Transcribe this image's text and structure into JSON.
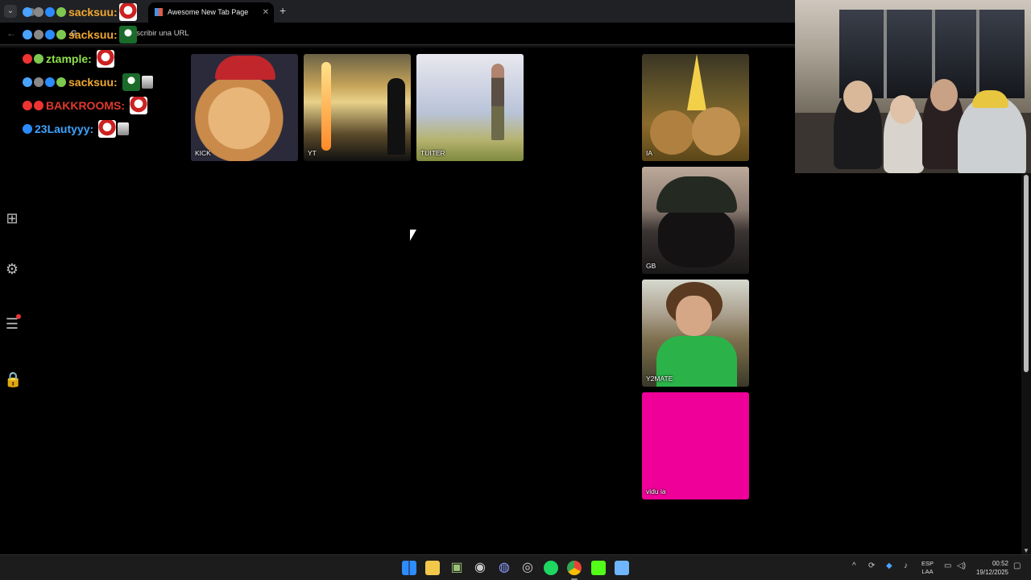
{
  "browser": {
    "tabs": [
      {
        "title": "",
        "active": false
      },
      {
        "title": "Awesome New Tab Page",
        "active": true
      }
    ],
    "new_tab_symbol": "+",
    "address_placeholder": "Busca en Google o escribe una URL",
    "address_visible_fragment": "o escribir una URL"
  },
  "chat": {
    "overlay_top": {
      "user": "sacksuu:",
      "color": "#f0a830"
    },
    "overlay_address": {
      "user": "sacksuu:",
      "color": "#f0a830"
    },
    "messages": [
      {
        "user": "ztample:",
        "color": "#8fe04a"
      },
      {
        "user": "sacksuu:",
        "color": "#f0a830"
      },
      {
        "user": "BAKKROOMS:",
        "color": "#e0392b"
      },
      {
        "user": "23Lautyyy:",
        "color": "#3fa4ff"
      }
    ]
  },
  "sidebar": {
    "icons": [
      "add-tile-icon",
      "gear-icon",
      "widgets-icon",
      "lock-icon"
    ]
  },
  "tiles": [
    {
      "label": "KICK"
    },
    {
      "label": "YT"
    },
    {
      "label": "TUITER"
    },
    {
      "label": "IA"
    },
    {
      "label": "GB"
    },
    {
      "label": "Y2MATE"
    },
    {
      "label": "vidu ia",
      "color": "#ee0099"
    }
  ],
  "taskbar": {
    "language": [
      "ESP",
      "LAA"
    ],
    "time": "00:52",
    "date": "19/12/2025"
  }
}
